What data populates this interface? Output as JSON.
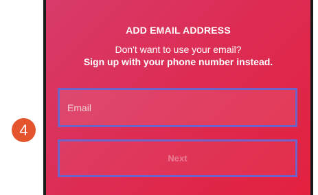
{
  "header": {
    "title": "ADD EMAIL ADDRESS",
    "subtitle": "Don't want to use your email?",
    "phone_link": "Sign up with your phone number instead."
  },
  "form": {
    "email_placeholder": "Email",
    "email_value": "",
    "next_label": "Next"
  },
  "annotation": {
    "step_number": "4"
  },
  "colors": {
    "gradient_start": "#d83c6a",
    "gradient_end": "#e3213e",
    "highlight_border": "#6e63c9",
    "step_badge": "#e4552e"
  }
}
